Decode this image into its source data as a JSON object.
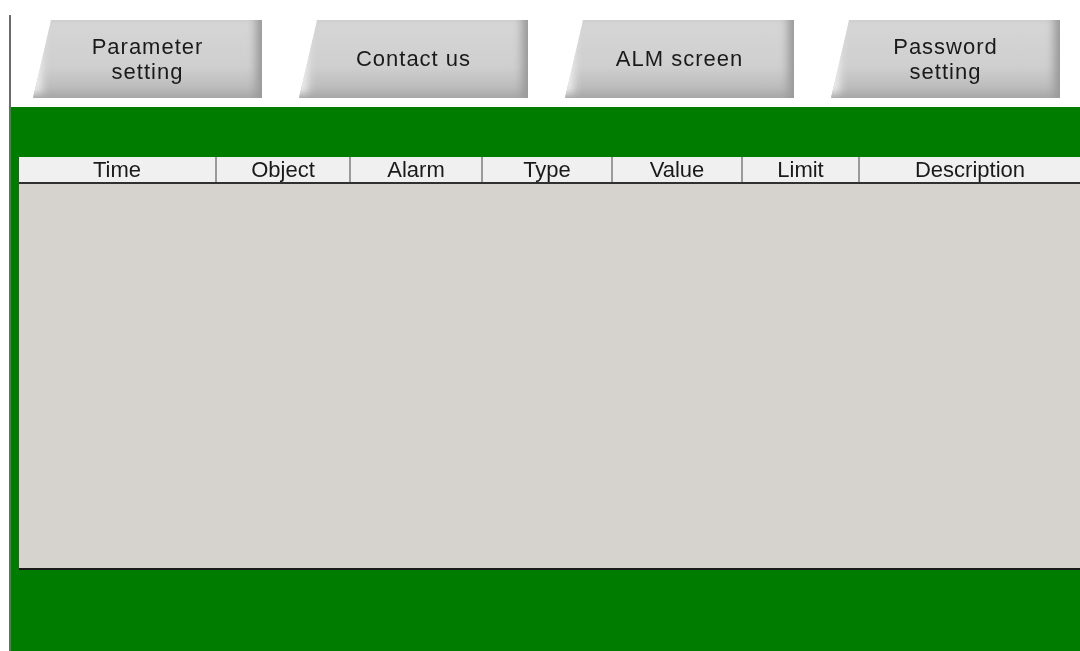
{
  "buttons": [
    {
      "label": "Parameter setting"
    },
    {
      "label": "Contact us"
    },
    {
      "label": "ALM screen"
    },
    {
      "label": "Password setting"
    }
  ],
  "alarm_table": {
    "columns": [
      "Time",
      "Object",
      "Alarm",
      "Type",
      "Value",
      "Limit",
      "Description"
    ]
  }
}
